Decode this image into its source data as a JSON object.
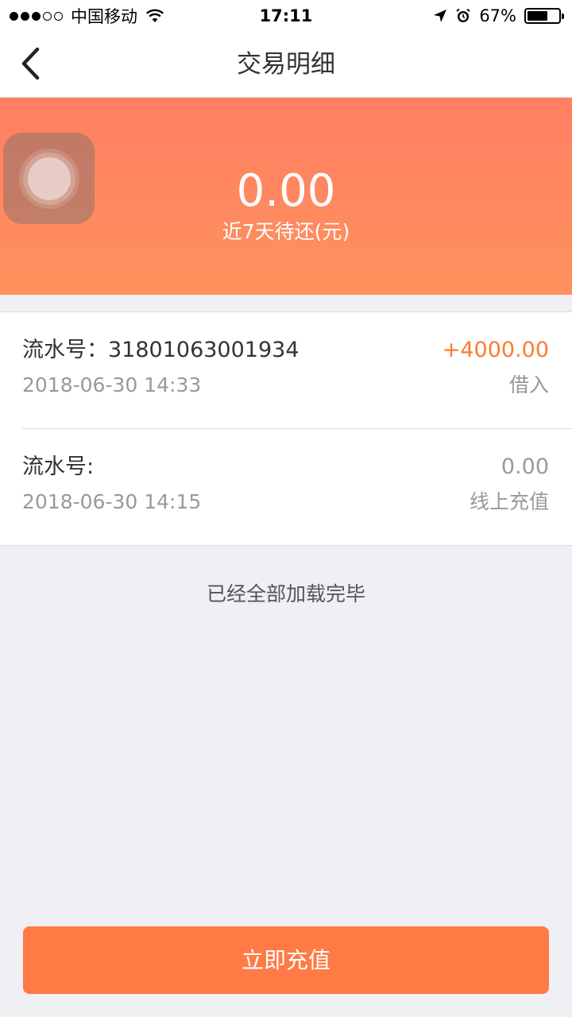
{
  "status_bar": {
    "carrier": "中国移动",
    "time": "17:11",
    "battery": "67%",
    "battery_level": 0.67,
    "signal_bars_filled": 3,
    "signal_bars_total": 5
  },
  "nav": {
    "title": "交易明细",
    "back_icon": "chevron-left-icon"
  },
  "summary": {
    "amount": "0.00",
    "label": "近7天待还(元)"
  },
  "transactions": [
    {
      "serial": "流水号：31801063001934",
      "date": "2018-06-30 14:33",
      "amount": "+4000.00",
      "type": "借入"
    },
    {
      "serial": "流水号:",
      "date": "2018-06-30 14:15",
      "amount": "0.00",
      "type": "线上充值"
    }
  ],
  "load_status": "已经全部加载完毕",
  "recharge_button": "立即充值",
  "colors": {
    "accent": "#ff7a45",
    "positive_amount": "#ff7a2f",
    "banner_top": "#ff7f62",
    "banner_bottom": "#ff915e",
    "background": "#efeff4"
  }
}
